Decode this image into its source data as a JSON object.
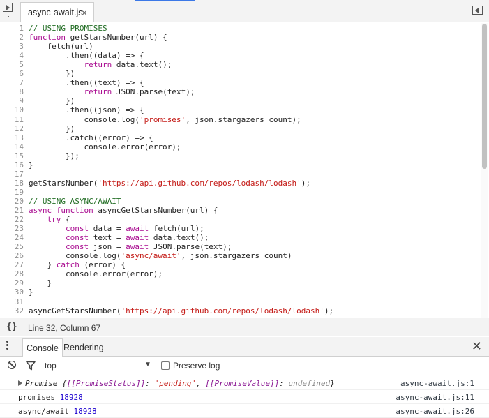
{
  "top_tabs": {
    "file_tab": "async-await.js",
    "close_glyph": "×"
  },
  "editor": {
    "lines": [
      {
        "n": "1",
        "tokens": [
          {
            "t": "// USING PROMISES",
            "c": "cm"
          }
        ]
      },
      {
        "n": "2",
        "tokens": [
          {
            "t": "function",
            "c": "kw"
          },
          {
            "t": " getStarsNumber(url) {",
            "c": ""
          }
        ]
      },
      {
        "n": "3",
        "tokens": [
          {
            "t": "    fetch(url)",
            "c": ""
          }
        ]
      },
      {
        "n": "4",
        "tokens": [
          {
            "t": "        .then((data) => {",
            "c": ""
          }
        ]
      },
      {
        "n": "5",
        "tokens": [
          {
            "t": "            ",
            "c": ""
          },
          {
            "t": "return",
            "c": "kw"
          },
          {
            "t": " data.text();",
            "c": ""
          }
        ]
      },
      {
        "n": "6",
        "tokens": [
          {
            "t": "        })",
            "c": ""
          }
        ]
      },
      {
        "n": "7",
        "tokens": [
          {
            "t": "        .then((text) => {",
            "c": ""
          }
        ]
      },
      {
        "n": "8",
        "tokens": [
          {
            "t": "            ",
            "c": ""
          },
          {
            "t": "return",
            "c": "kw"
          },
          {
            "t": " JSON.parse(text);",
            "c": ""
          }
        ]
      },
      {
        "n": "9",
        "tokens": [
          {
            "t": "        })",
            "c": ""
          }
        ]
      },
      {
        "n": "10",
        "tokens": [
          {
            "t": "        .then((json) => {",
            "c": ""
          }
        ]
      },
      {
        "n": "11",
        "tokens": [
          {
            "t": "            console.log(",
            "c": ""
          },
          {
            "t": "'promises'",
            "c": "str"
          },
          {
            "t": ", json.stargazers_count);",
            "c": ""
          }
        ]
      },
      {
        "n": "12",
        "tokens": [
          {
            "t": "        })",
            "c": ""
          }
        ]
      },
      {
        "n": "13",
        "tokens": [
          {
            "t": "        .catch((error) => {",
            "c": ""
          }
        ]
      },
      {
        "n": "14",
        "tokens": [
          {
            "t": "            console.error(error);",
            "c": ""
          }
        ]
      },
      {
        "n": "15",
        "tokens": [
          {
            "t": "        });",
            "c": ""
          }
        ]
      },
      {
        "n": "16",
        "tokens": [
          {
            "t": "}",
            "c": ""
          }
        ]
      },
      {
        "n": "17",
        "tokens": []
      },
      {
        "n": "18",
        "tokens": [
          {
            "t": "getStarsNumber(",
            "c": ""
          },
          {
            "t": "'https://api.github.com/repos/lodash/lodash'",
            "c": "str"
          },
          {
            "t": ");",
            "c": ""
          }
        ]
      },
      {
        "n": "19",
        "tokens": []
      },
      {
        "n": "20",
        "tokens": [
          {
            "t": "// USING ASYNC/AWAIT",
            "c": "cm"
          }
        ]
      },
      {
        "n": "21",
        "tokens": [
          {
            "t": "async",
            "c": "kw"
          },
          {
            "t": " ",
            "c": ""
          },
          {
            "t": "function",
            "c": "kw"
          },
          {
            "t": " asyncGetStarsNumber(url) {",
            "c": ""
          }
        ]
      },
      {
        "n": "22",
        "tokens": [
          {
            "t": "    ",
            "c": ""
          },
          {
            "t": "try",
            "c": "kw"
          },
          {
            "t": " {",
            "c": ""
          }
        ]
      },
      {
        "n": "23",
        "tokens": [
          {
            "t": "        ",
            "c": ""
          },
          {
            "t": "const",
            "c": "kw"
          },
          {
            "t": " data = ",
            "c": ""
          },
          {
            "t": "await",
            "c": "kw"
          },
          {
            "t": " fetch(url);",
            "c": ""
          }
        ]
      },
      {
        "n": "24",
        "tokens": [
          {
            "t": "        ",
            "c": ""
          },
          {
            "t": "const",
            "c": "kw"
          },
          {
            "t": " text = ",
            "c": ""
          },
          {
            "t": "await",
            "c": "kw"
          },
          {
            "t": " data.text();",
            "c": ""
          }
        ]
      },
      {
        "n": "25",
        "tokens": [
          {
            "t": "        ",
            "c": ""
          },
          {
            "t": "const",
            "c": "kw"
          },
          {
            "t": " json = ",
            "c": ""
          },
          {
            "t": "await",
            "c": "kw"
          },
          {
            "t": " JSON.parse(text);",
            "c": ""
          }
        ]
      },
      {
        "n": "26",
        "tokens": [
          {
            "t": "        console.log(",
            "c": ""
          },
          {
            "t": "'async/await'",
            "c": "str"
          },
          {
            "t": ", json.stargazers_count)",
            "c": ""
          }
        ]
      },
      {
        "n": "27",
        "tokens": [
          {
            "t": "    } ",
            "c": ""
          },
          {
            "t": "catch",
            "c": "kw"
          },
          {
            "t": " (error) {",
            "c": ""
          }
        ]
      },
      {
        "n": "28",
        "tokens": [
          {
            "t": "        console.error(error);",
            "c": ""
          }
        ]
      },
      {
        "n": "29",
        "tokens": [
          {
            "t": "    }",
            "c": ""
          }
        ]
      },
      {
        "n": "30",
        "tokens": [
          {
            "t": "}",
            "c": ""
          }
        ]
      },
      {
        "n": "31",
        "tokens": []
      },
      {
        "n": "32",
        "tokens": [
          {
            "t": "asyncGetStarsNumber(",
            "c": ""
          },
          {
            "t": "'https://api.github.com/repos/lodash/lodash'",
            "c": "str"
          },
          {
            "t": ");",
            "c": ""
          }
        ]
      }
    ]
  },
  "status_bar": {
    "braces": "{}",
    "cursor_position": "Line 32, Column 67"
  },
  "drawer": {
    "tabs": [
      {
        "label": "Console"
      },
      {
        "label": "Rendering"
      }
    ],
    "close_glyph": "✕"
  },
  "console_toolbar": {
    "context": "top",
    "caret": "▼",
    "preserve_log_label": "Preserve log",
    "preserve_log_checked": false
  },
  "console": {
    "promise_message": {
      "prefix": "Promise {",
      "status_key": "[[PromiseStatus]]",
      "sep1": ": ",
      "status_value": "\"pending\"",
      "sep2": ", ",
      "value_key": "[[PromiseValue]]",
      "sep3": ": ",
      "value": "undefined",
      "suffix": "}",
      "source": "async-await.js:1"
    },
    "messages": [
      {
        "label": "promises",
        "value": "18928",
        "source": "async-await.js:11"
      },
      {
        "label": "async/await",
        "value": "18928",
        "source": "async-await.js:26"
      }
    ]
  }
}
